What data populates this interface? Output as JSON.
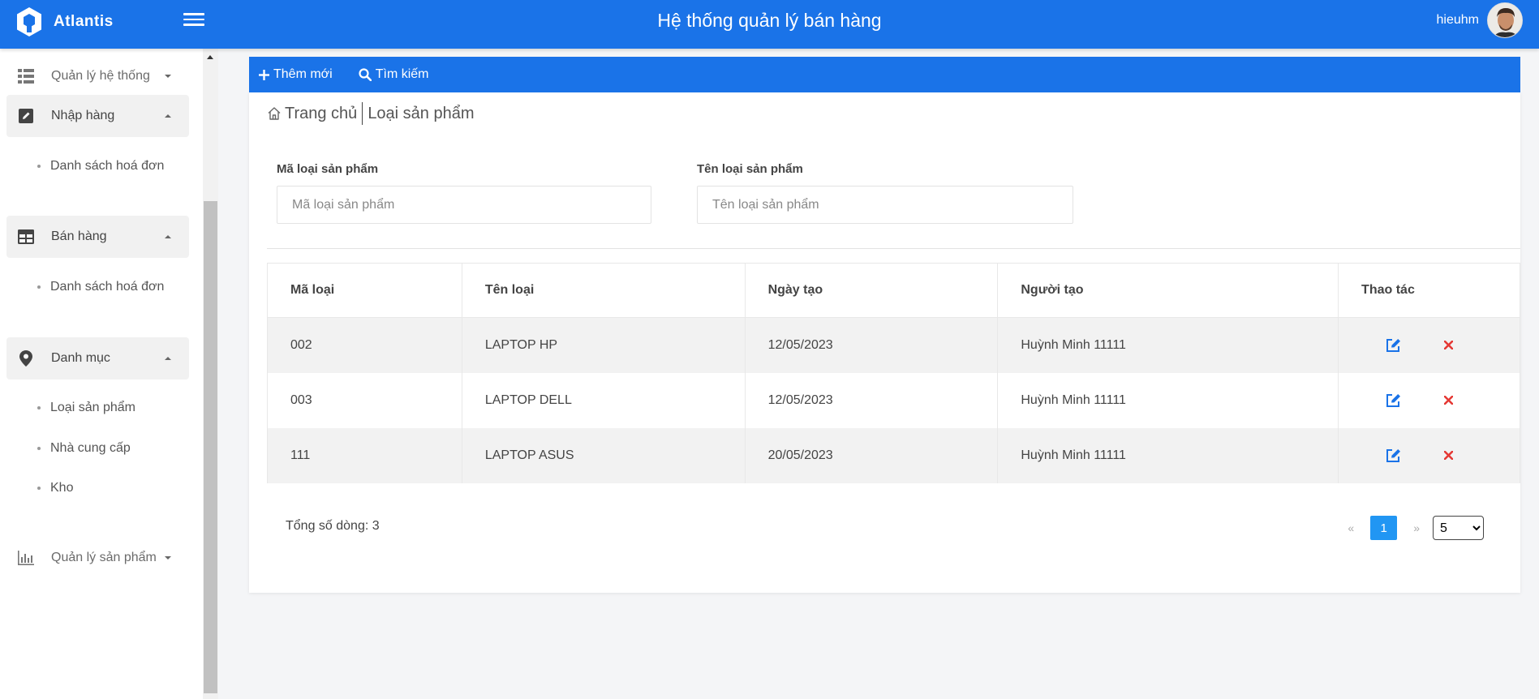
{
  "header": {
    "brand": "Atlantis",
    "title": "Hệ thống quản lý bán hàng",
    "username": "hieuhm"
  },
  "sidebar": {
    "groups": [
      {
        "label": "Quản lý hệ thống",
        "icon": "list-icon"
      },
      {
        "label": "Nhập hàng",
        "icon": "edit-square-icon",
        "items": [
          "Danh sách hoá đơn"
        ]
      },
      {
        "label": "Bán hàng",
        "icon": "table-icon",
        "items": [
          "Danh sách hoá đơn"
        ]
      },
      {
        "label": "Danh mục",
        "icon": "map-pin-icon",
        "items": [
          "Loại sản phẩm",
          "Nhà cung cấp",
          "Kho"
        ]
      },
      {
        "label": "Quản lý sản phẩm",
        "icon": "bar-chart-icon"
      }
    ]
  },
  "toolbar": {
    "add_label": "Thêm mới",
    "search_label": "Tìm kiếm"
  },
  "breadcrumb": {
    "home": "Trang chủ",
    "current": "Loại sản phẩm"
  },
  "filters": {
    "code_label": "Mã loại sản phẩm",
    "code_placeholder": "Mã loại sản phẩm",
    "name_label": "Tên loại sản phẩm",
    "name_placeholder": "Tên loại sản phẩm"
  },
  "table": {
    "columns": [
      "Mã loại",
      "Tên loại",
      "Ngày tạo",
      "Người tạo",
      "Thao tác"
    ],
    "rows": [
      [
        "002",
        "LAPTOP HP",
        "12/05/2023",
        "Huỳnh Minh 11111"
      ],
      [
        "003",
        "LAPTOP DELL",
        "12/05/2023",
        "Huỳnh Minh 11111"
      ],
      [
        "111",
        "LAPTOP ASUS",
        "20/05/2023",
        "Huỳnh Minh 11111"
      ]
    ]
  },
  "footer": {
    "total_label": "Tổng số dòng: 3",
    "prev": "«",
    "page": "1",
    "next": "»",
    "page_size": "5"
  },
  "colors": {
    "primary": "#1a73e8",
    "pager_active": "#2196f3",
    "delete": "#e53935"
  }
}
